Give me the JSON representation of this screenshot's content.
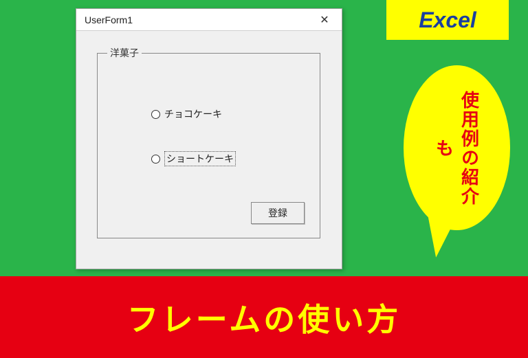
{
  "badge": {
    "label": "Excel"
  },
  "bubble": {
    "text": "使用例の紹介も"
  },
  "banner": {
    "text": "フレームの使い方"
  },
  "userform": {
    "title": "UserForm1",
    "close": "✕",
    "frame_legend": "洋菓子",
    "options": [
      {
        "label": "チョコケーキ"
      },
      {
        "label": "ショートケーキ"
      }
    ],
    "submit_label": "登録"
  }
}
